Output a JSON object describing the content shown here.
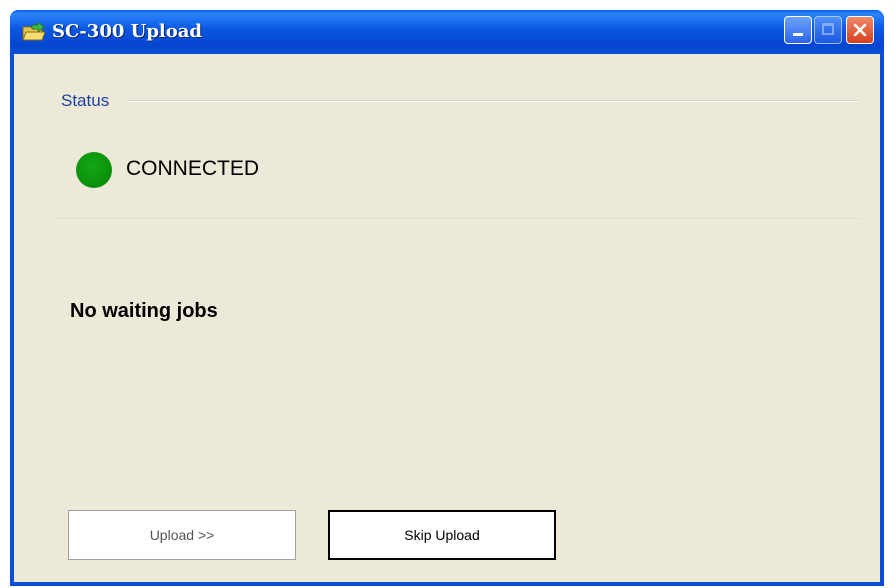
{
  "window": {
    "title": "SC-300 Upload",
    "title_icon": "folder-arrow-icon",
    "controls": [
      "minimize-icon",
      "maximize-icon",
      "close-icon"
    ]
  },
  "status_group": {
    "label": "Status",
    "indicator_color": "#0b8f0b",
    "status_text": "CONNECTED"
  },
  "jobs": {
    "message": "No waiting jobs"
  },
  "buttons": {
    "upload_label": "Upload >>",
    "skip_label": "Skip Upload"
  }
}
